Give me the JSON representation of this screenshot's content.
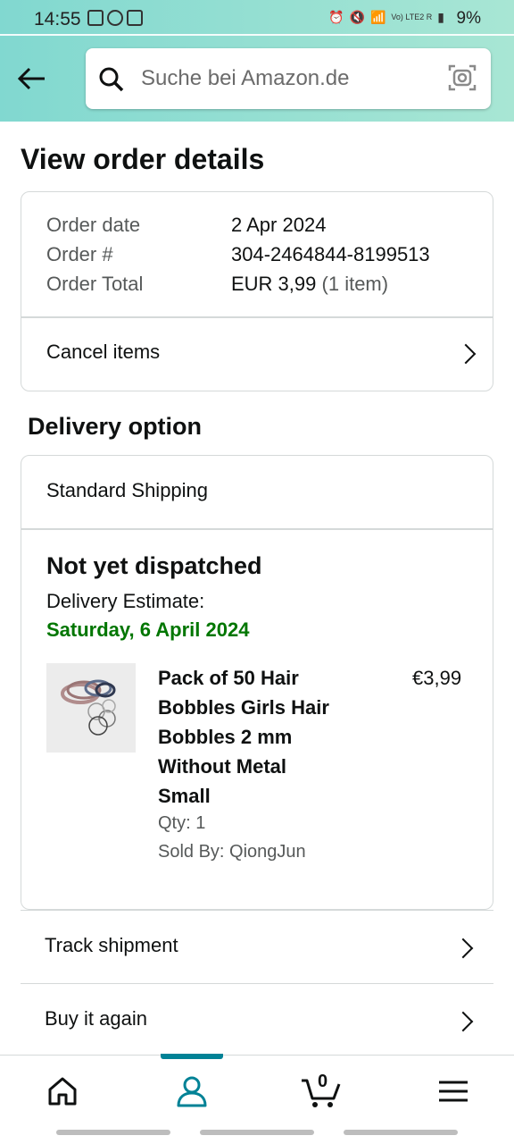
{
  "status_bar": {
    "time": "14:55",
    "battery": "9%",
    "network_label": "Vo) LTE2 R"
  },
  "header": {
    "search_placeholder": "Suche bei Amazon.de",
    "icons": [
      "back-arrow-icon",
      "search-icon",
      "camera-scan-icon"
    ]
  },
  "page": {
    "title": "View order details"
  },
  "order_summary": {
    "rows": [
      {
        "label": "Order date",
        "value": "2 Apr 2024"
      },
      {
        "label": "Order #",
        "value": "304-2464844-8199513"
      },
      {
        "label": "Order Total",
        "value": "EUR 3,99",
        "extra": "(1 item)"
      }
    ],
    "cancel_label": "Cancel items"
  },
  "delivery": {
    "section_title": "Delivery option",
    "method": "Standard Shipping",
    "status": "Not yet dispatched",
    "estimate_label": "Delivery Estimate:",
    "estimate_date": "Saturday, 6 April 2024",
    "estimate_color": "#007600",
    "item": {
      "name_lines": [
        "Pack of 50 Hair",
        "Bobbles Girls Hair",
        "Bobbles 2 mm",
        "Without Metal",
        "Small"
      ],
      "price": "€3,99",
      "qty": "Qty: 1",
      "sold_by": "Sold By: QiongJun"
    }
  },
  "actions": {
    "track": "Track shipment",
    "buy_again": "Buy it again"
  },
  "bottom_nav": {
    "cart_count": "0",
    "active": "account",
    "accent_color": "#008296",
    "items": [
      "home-icon",
      "account-icon",
      "cart-icon",
      "menu-icon"
    ]
  }
}
